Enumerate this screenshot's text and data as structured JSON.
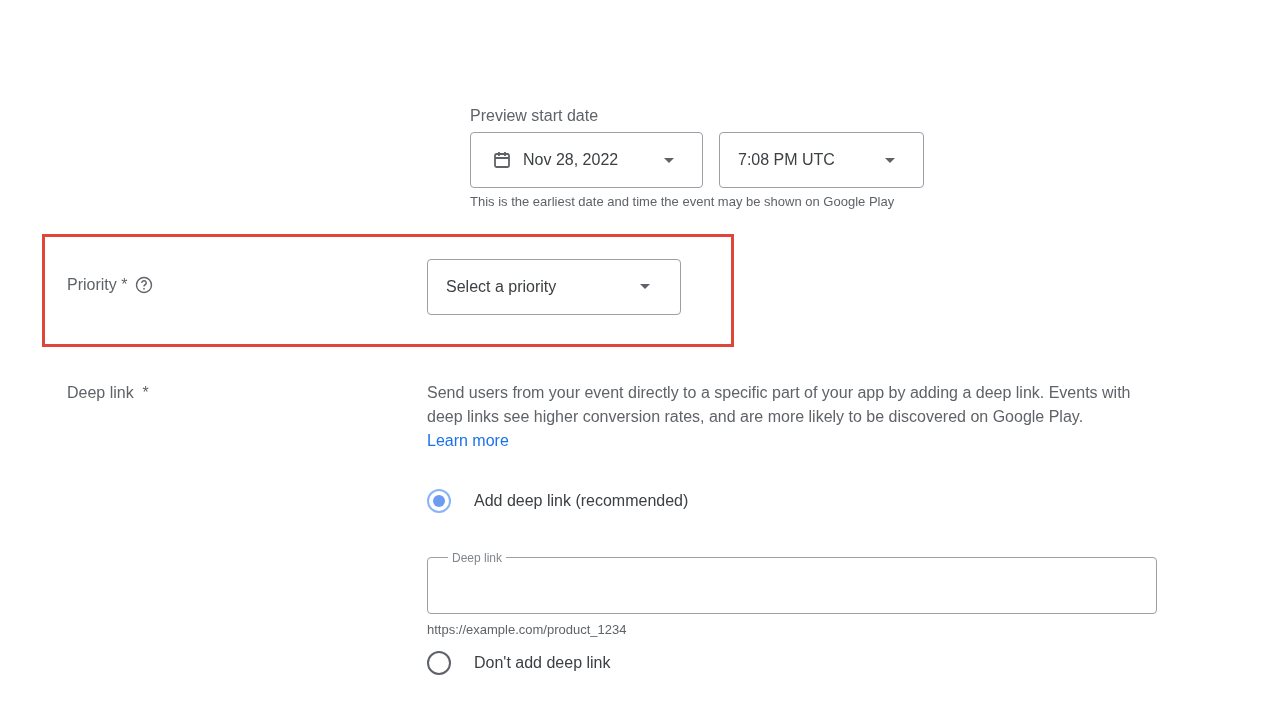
{
  "preview_start": {
    "label": "Preview start date",
    "date": "Nov 28, 2022",
    "time": "7:08 PM UTC",
    "helper": "This is the earliest date and time the event may be shown on Google Play"
  },
  "priority": {
    "label": "Priority *",
    "value": "Select a priority",
    "highlighted": true
  },
  "deep_link": {
    "label": "Deep link  *",
    "description": "Send users from your event directly to a specific part of your app by adding a deep link. Events with deep links see higher conversion rates, and are more likely to be discovered on Google Play.",
    "link": "Learn more",
    "options": [
      {
        "label": "Add deep link (recommended)",
        "selected": true
      },
      {
        "label": "Don't add deep link",
        "selected": false
      }
    ],
    "field": {
      "label": "Deep link",
      "helper": "https://example.com/product_1234"
    }
  }
}
